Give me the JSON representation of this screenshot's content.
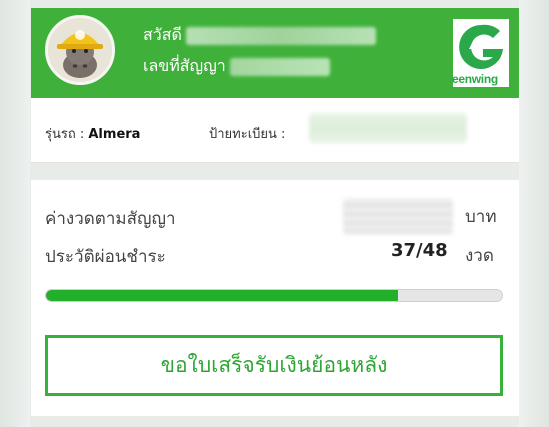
{
  "header": {
    "greeting_prefix": "สวัสดี",
    "contract_prefix": "เลขที่สัญญา",
    "logo_text": "eenwing",
    "accent": "#3fb13b"
  },
  "car": {
    "model_label": "รุ่นรถ : ",
    "model_value": "Almera",
    "plate_label": "ป้ายทะเบียน :"
  },
  "payment": {
    "installment_label": "ค่างวดตามสัญญา",
    "installment_unit": "บาท",
    "history_label": "ประวัติผ่อนชำระ",
    "paid_count": "37/48",
    "count_unit": "งวด",
    "progress_fraction": 0.771,
    "progress_color": "#22b02a"
  },
  "actions": {
    "receipt_button": "ขอใบเสร็จรับเงินย้อนหลัง"
  }
}
